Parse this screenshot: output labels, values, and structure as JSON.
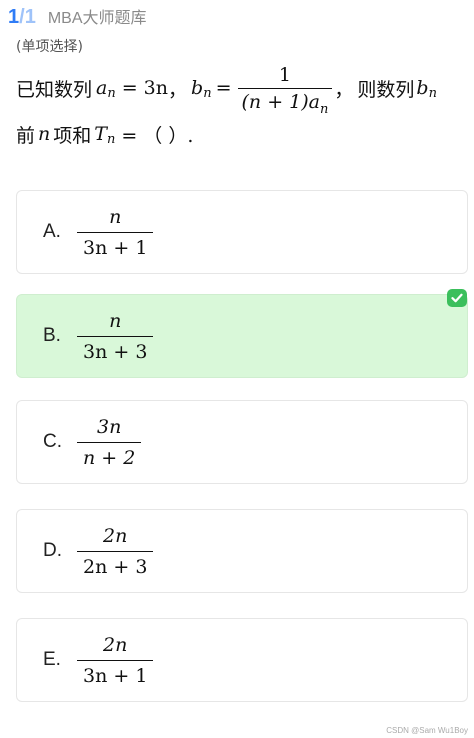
{
  "header": {
    "counter_current": "1",
    "counter_sep": "/",
    "counter_total": "1",
    "app_title": "MBA大师题库"
  },
  "question": {
    "type_label": "(单项选择)",
    "stem_text_1": "已知数列",
    "stem_a": "a",
    "stem_sub_n": "n",
    "stem_eq_3n": "= 3n",
    "stem_comma_1": "，",
    "stem_b": "b",
    "stem_eq": "=",
    "stem_frac_num": "1",
    "stem_frac_den_pre": "(n + 1)a",
    "stem_comma_2": "，",
    "stem_text_2": "则数列",
    "stem_text_3": "前",
    "stem_n": "n",
    "stem_text_4": "项和",
    "stem_T": "T",
    "stem_tail": "= （  ）."
  },
  "options": [
    {
      "letter": "A.",
      "numerator": "n",
      "denominator": "3n + 1",
      "selected": false
    },
    {
      "letter": "B.",
      "numerator": "n",
      "denominator": "3n + 3",
      "selected": true
    },
    {
      "letter": "C.",
      "numerator": "3n",
      "denominator": "n + 2",
      "selected": false
    },
    {
      "letter": "D.",
      "numerator": "2n",
      "denominator": "2n + 3",
      "selected": false
    },
    {
      "letter": "E.",
      "numerator": "2n",
      "denominator": "3n + 1",
      "selected": false
    }
  ],
  "icons": {
    "selected_marker": "check-icon"
  },
  "colors": {
    "accent": "#2f7cf6",
    "selected_bg": "#d9f8d9",
    "check_green": "#3bbf5c"
  },
  "watermark": "CSDN @Sam Wu1Boy"
}
